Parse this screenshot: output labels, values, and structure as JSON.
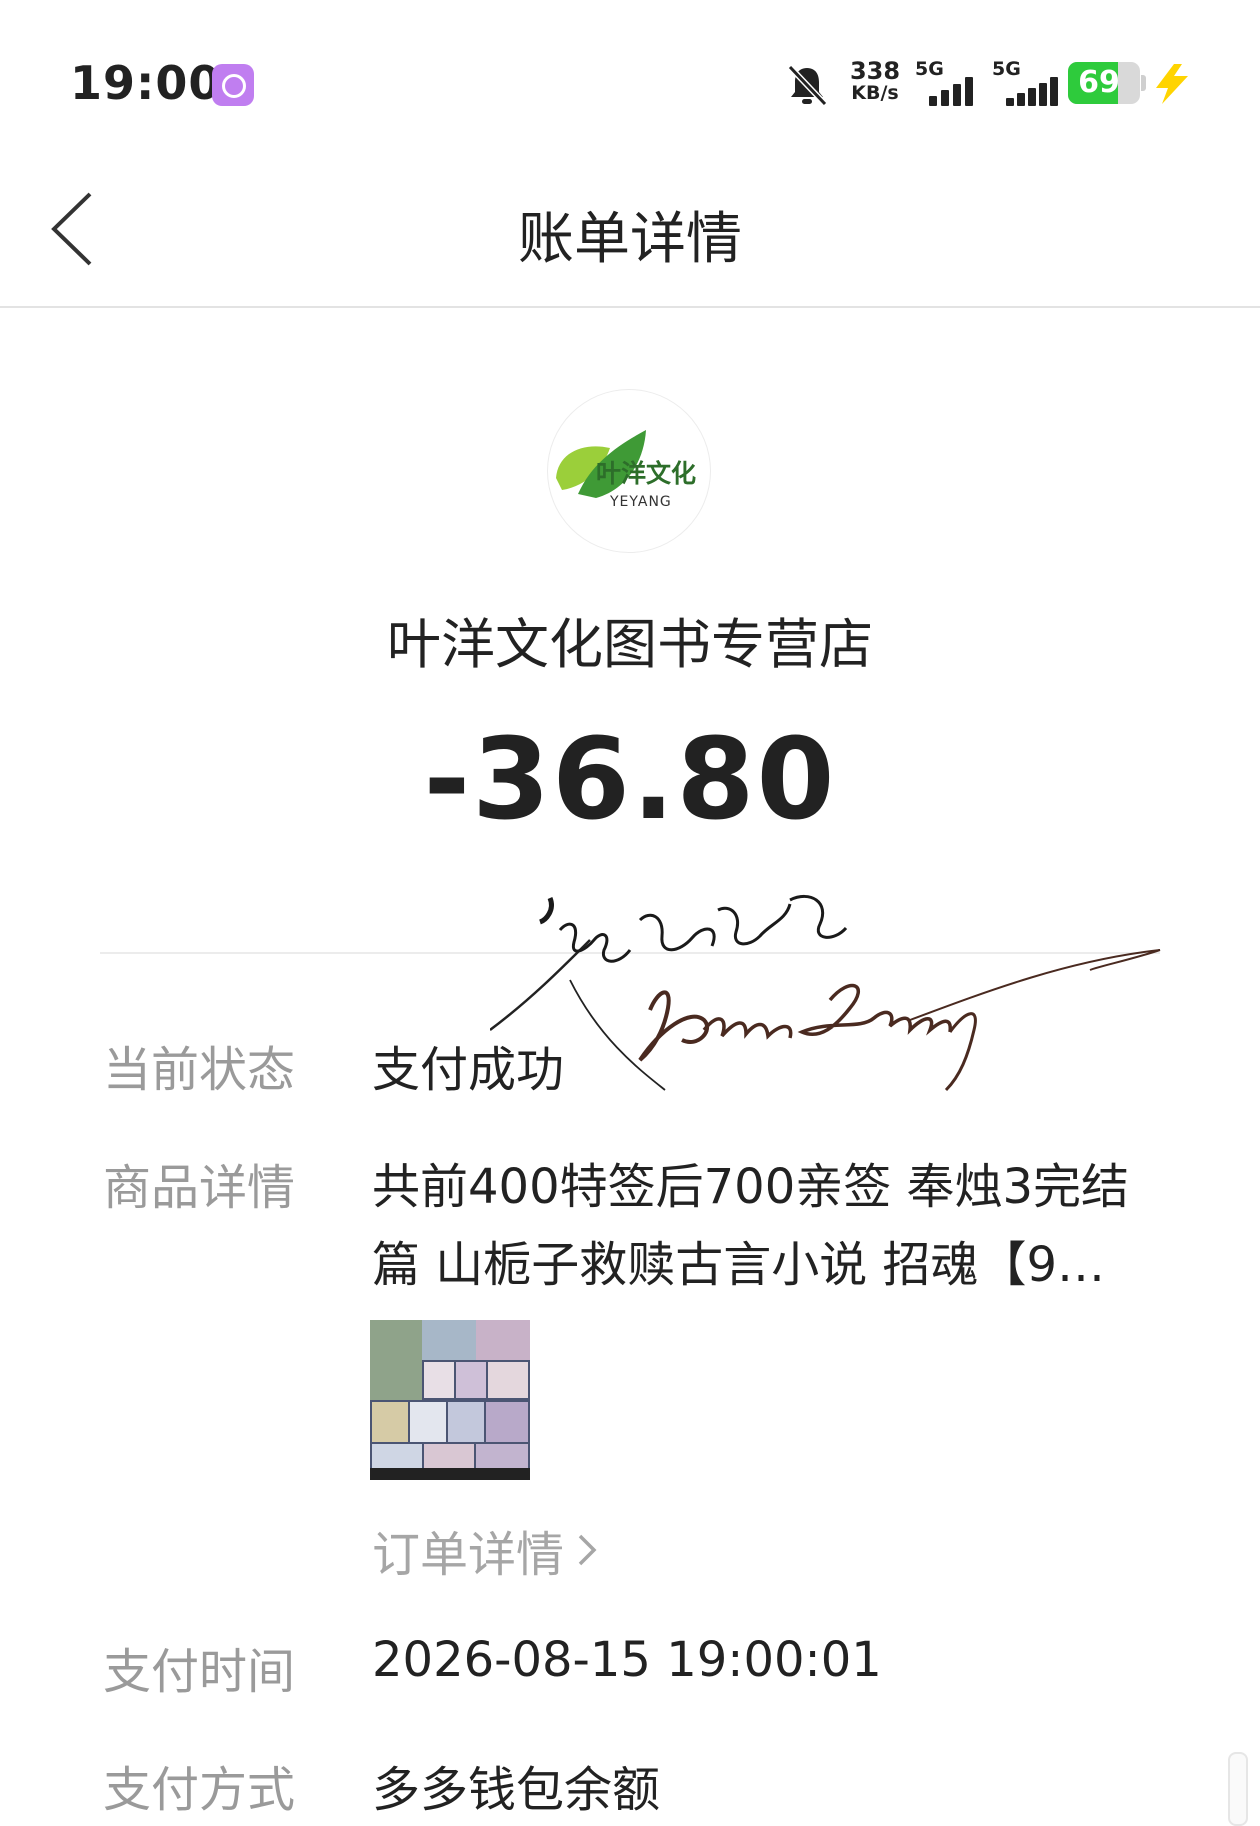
{
  "status_bar": {
    "time": "19:00",
    "net_speed_value": "338",
    "net_speed_unit": "KB/s",
    "signal1_label": "5G",
    "signal2_label": "5G",
    "battery_level": "69",
    "battery_fraction": 0.69,
    "battery_color": "#2ecb3c",
    "icons": [
      "app-notification-icon",
      "mute-bell-icon",
      "signal-icon",
      "battery-icon",
      "charging-icon"
    ]
  },
  "header": {
    "title": "账单详情",
    "back_icon": "chevron-left-icon"
  },
  "merchant": {
    "logo_text": "叶洋文化",
    "logo_subtext": "YEYANG",
    "name": "叶洋文化图书专营店"
  },
  "amount": "-36.80",
  "signature_text": "Bree Sassy",
  "details": {
    "status_label": "当前状态",
    "status_value": "支付成功",
    "product_label": "商品详情",
    "product_value": "共前400特签后700亲签 奉烛3完结篇 山栀子救赎古言小说 招魂【9…",
    "order_link": "订单详情",
    "pay_time_label": "支付时间",
    "pay_time_value": "2026-08-15 19:00:01",
    "pay_method_label": "支付方式",
    "pay_method_value": "多多钱包余额"
  }
}
